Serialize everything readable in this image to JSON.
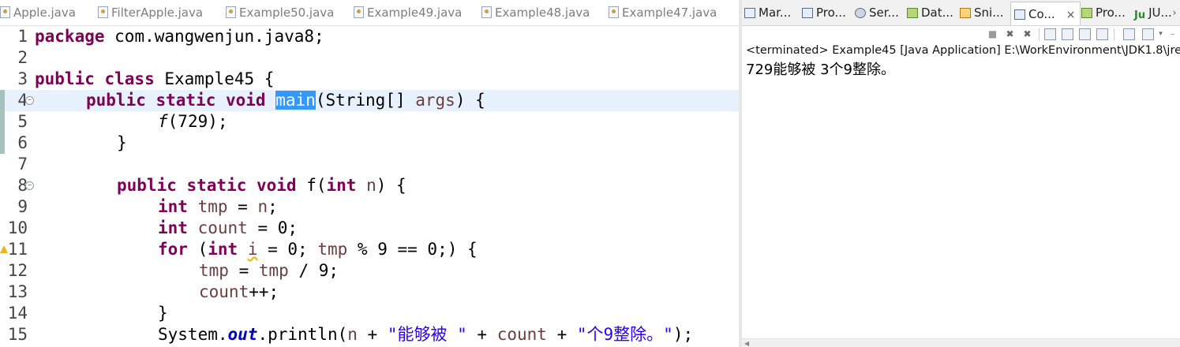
{
  "editor": {
    "tabs": [
      {
        "label": "Apple.java"
      },
      {
        "label": "FilterApple.java"
      },
      {
        "label": "Example50.java"
      },
      {
        "label": "Example49.java"
      },
      {
        "label": "Example48.java"
      },
      {
        "label": "Example47.java"
      }
    ],
    "line_numbers": [
      "1",
      "2",
      "3",
      "4",
      "5",
      "6",
      "7",
      "8",
      "9",
      "10",
      "11",
      "12",
      "13",
      "14",
      "15"
    ],
    "fold_marker": "−",
    "code": {
      "l1_kw": "package",
      "l1_rest": " com.wangwenjun.java8;",
      "l3_kw": "public class",
      "l3_rest": " Example45 {",
      "l4_kw": "public static void",
      "l4_sel": "main",
      "l4_a": "(String[] ",
      "l4_var": "args",
      "l4_b": ") {",
      "l5_fn": "f",
      "l5_rest": "(729);",
      "l6": "}",
      "l8_kw": "public static void",
      "l8_a": " f(",
      "l8_kw2": "int",
      "l8_var": "n",
      "l8_b": ") {",
      "l9_kw": "int",
      "l9_var": "tmp",
      "l9_a": " = ",
      "l9_var2": "n",
      "l9_b": ";",
      "l10_kw": "int",
      "l10_var": "count",
      "l10_b": " = 0;",
      "l11_kw": "for",
      "l11_a": " (",
      "l11_kw2": "int",
      "l11_var": "i",
      "l11_b": " = 0; ",
      "l11_var2": "tmp",
      "l11_c": " % 9 == 0;) {",
      "l12_var": "tmp",
      "l12_a": " = ",
      "l12_var2": "tmp",
      "l12_b": " / 9;",
      "l13_var": "count",
      "l13_b": "++;",
      "l14": "}",
      "l15_a": "System.",
      "l15_out": "out",
      "l15_b": ".println(",
      "l15_var": "n",
      "l15_c": " + ",
      "l15_str1": "\"能够被 \"",
      "l15_d": " + ",
      "l15_var2": "count",
      "l15_e": " + ",
      "l15_str2": "\"个9整除。\"",
      "l15_f": ");"
    }
  },
  "views": {
    "tabs": [
      {
        "label": "Mar...",
        "icon": "markers-icon"
      },
      {
        "label": "Pro...",
        "icon": "properties-icon"
      },
      {
        "label": "Ser...",
        "icon": "servers-icon"
      },
      {
        "label": "Dat...",
        "icon": "data-source-icon"
      },
      {
        "label": "Sni...",
        "icon": "snippets-icon"
      },
      {
        "label": "Co...",
        "icon": "console-icon",
        "active": true
      },
      {
        "label": "Pro...",
        "icon": "progress-icon"
      },
      {
        "label": "JU...",
        "icon": "junit-icon"
      }
    ],
    "close_glyph": "×",
    "chevron": "›"
  },
  "console": {
    "status": "<terminated> Example45 [Java Application] E:\\WorkEnvironment\\JDK1.8\\jre\\",
    "output": "729能够被 3个9整除。"
  }
}
